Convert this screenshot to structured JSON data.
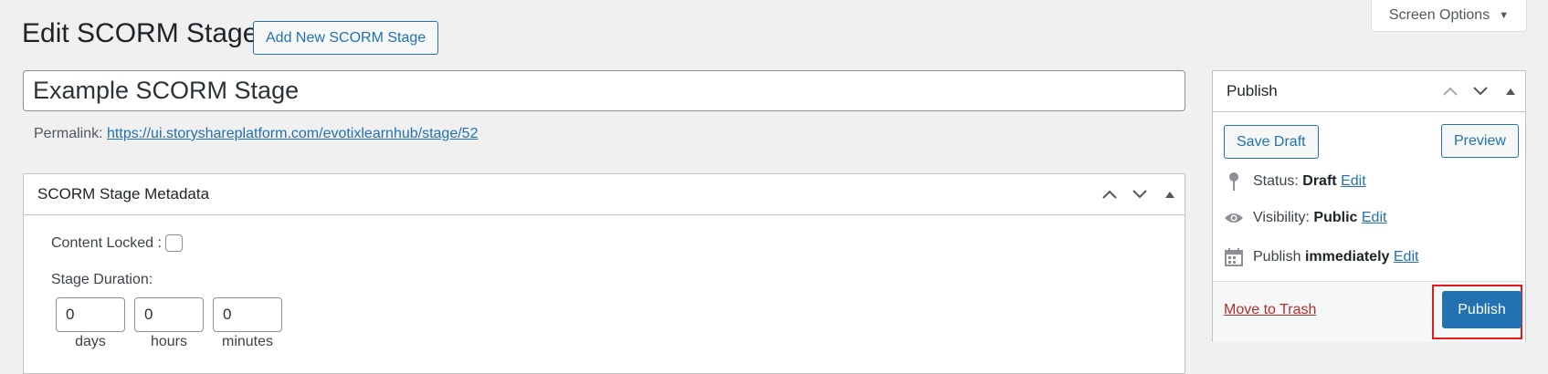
{
  "screen_options": {
    "label": "Screen Options",
    "caret": "▼"
  },
  "page": {
    "title": "Edit SCORM Stage",
    "add_new_label": "Add New SCORM Stage"
  },
  "post": {
    "title": "Example SCORM Stage"
  },
  "permalink": {
    "label": "Permalink:",
    "url": "https://ui.storyshareplatform.com/evotixlearnhub/stage/52"
  },
  "metadata_box": {
    "title": "SCORM Stage Metadata",
    "content_locked_label": "Content Locked :",
    "content_locked_checked": false,
    "stage_duration_label": "Stage Duration:",
    "durations": [
      {
        "value": "0",
        "label": "days"
      },
      {
        "value": "0",
        "label": "hours"
      },
      {
        "value": "0",
        "label": "minutes"
      }
    ]
  },
  "publish_box": {
    "title": "Publish",
    "save_draft_label": "Save Draft",
    "preview_label": "Preview",
    "status_label": "Status:",
    "status_value": "Draft",
    "visibility_label": "Visibility:",
    "visibility_value": "Public",
    "publish_label": "Publish",
    "publish_value": "immediately",
    "edit_label": "Edit",
    "trash_label": "Move to Trash",
    "publish_button_label": "Publish"
  },
  "colors": {
    "accent": "#2271b1",
    "danger": "#b32d2e",
    "highlight": "#e2191f"
  },
  "icons": {
    "status": "pin-icon",
    "visibility": "eye-icon",
    "schedule": "calendar-icon"
  }
}
